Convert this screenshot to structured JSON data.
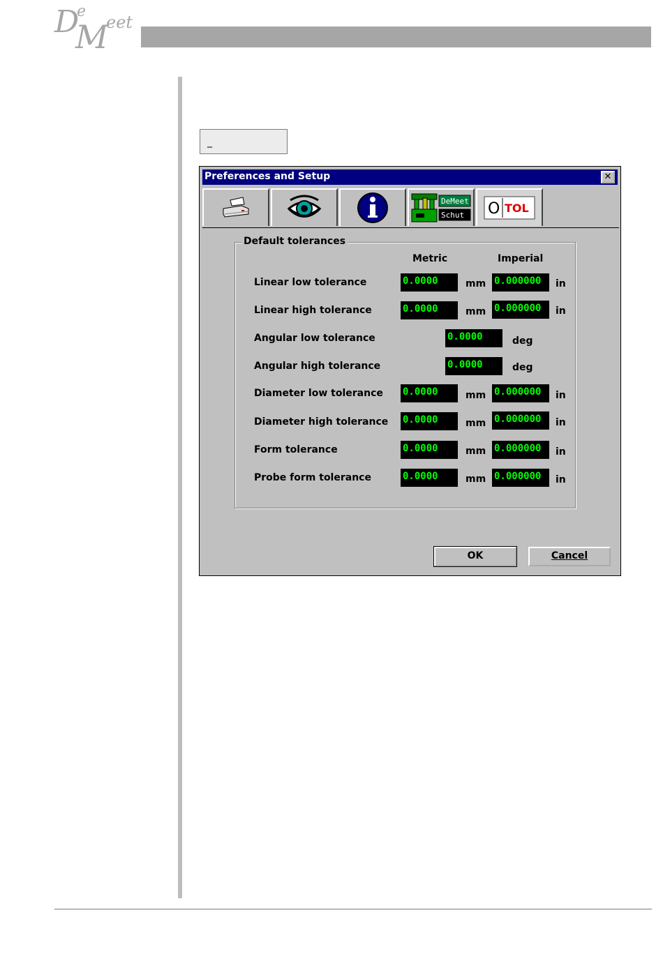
{
  "logo": {
    "d": "D",
    "e": "e",
    "m": "M",
    "eet": "eet"
  },
  "caption_box": {
    "text": "_"
  },
  "dialog": {
    "title": "Preferences and Setup",
    "close_label": "✕",
    "tabs": [
      {
        "name": "printer",
        "icon": "printer-icon"
      },
      {
        "name": "display",
        "icon": "eye-icon"
      },
      {
        "name": "info",
        "icon": "info-icon"
      },
      {
        "name": "machine",
        "icon": "machine-icon",
        "labels": [
          "DeMeet",
          "Schut"
        ]
      },
      {
        "name": "tolerance",
        "icon": "tolerance-icon",
        "labels": [
          "O",
          "TOL"
        ],
        "active": true
      }
    ],
    "group": {
      "title": "Default tolerances",
      "columns": {
        "metric": "Metric",
        "imperial": "Imperial"
      },
      "rows": [
        {
          "label": "Linear low tolerance",
          "metric": "0.0000",
          "metric_unit": "mm",
          "imperial": "0.000000",
          "imperial_unit": "in"
        },
        {
          "label": "Linear high tolerance",
          "metric": "0.0000",
          "metric_unit": "mm",
          "imperial": "0.000000",
          "imperial_unit": "in"
        },
        {
          "label": "Angular low tolerance",
          "value": "0.0000",
          "unit": "deg"
        },
        {
          "label": "Angular high tolerance",
          "value": "0.0000",
          "unit": "deg"
        },
        {
          "label": "Diameter low tolerance",
          "metric": "0.0000",
          "metric_unit": "mm",
          "imperial": "0.000000",
          "imperial_unit": "in"
        },
        {
          "label": "Diameter high tolerance",
          "metric": "0.0000",
          "metric_unit": "mm",
          "imperial": "0.000000",
          "imperial_unit": "in"
        },
        {
          "label": "Form tolerance",
          "metric": "0.0000",
          "metric_unit": "mm",
          "imperial": "0.000000",
          "imperial_unit": "in"
        },
        {
          "label": "Probe form tolerance",
          "metric": "0.0000",
          "metric_unit": "mm",
          "imperial": "0.000000",
          "imperial_unit": "in"
        }
      ]
    },
    "buttons": {
      "ok": "OK",
      "cancel": "Cancel"
    }
  },
  "colors": {
    "title_bar": "#000080",
    "dialog_bg": "#c0c0c0",
    "field_bg": "#000000",
    "field_text": "#00ff00",
    "header_bar": "#a6a6a6"
  }
}
